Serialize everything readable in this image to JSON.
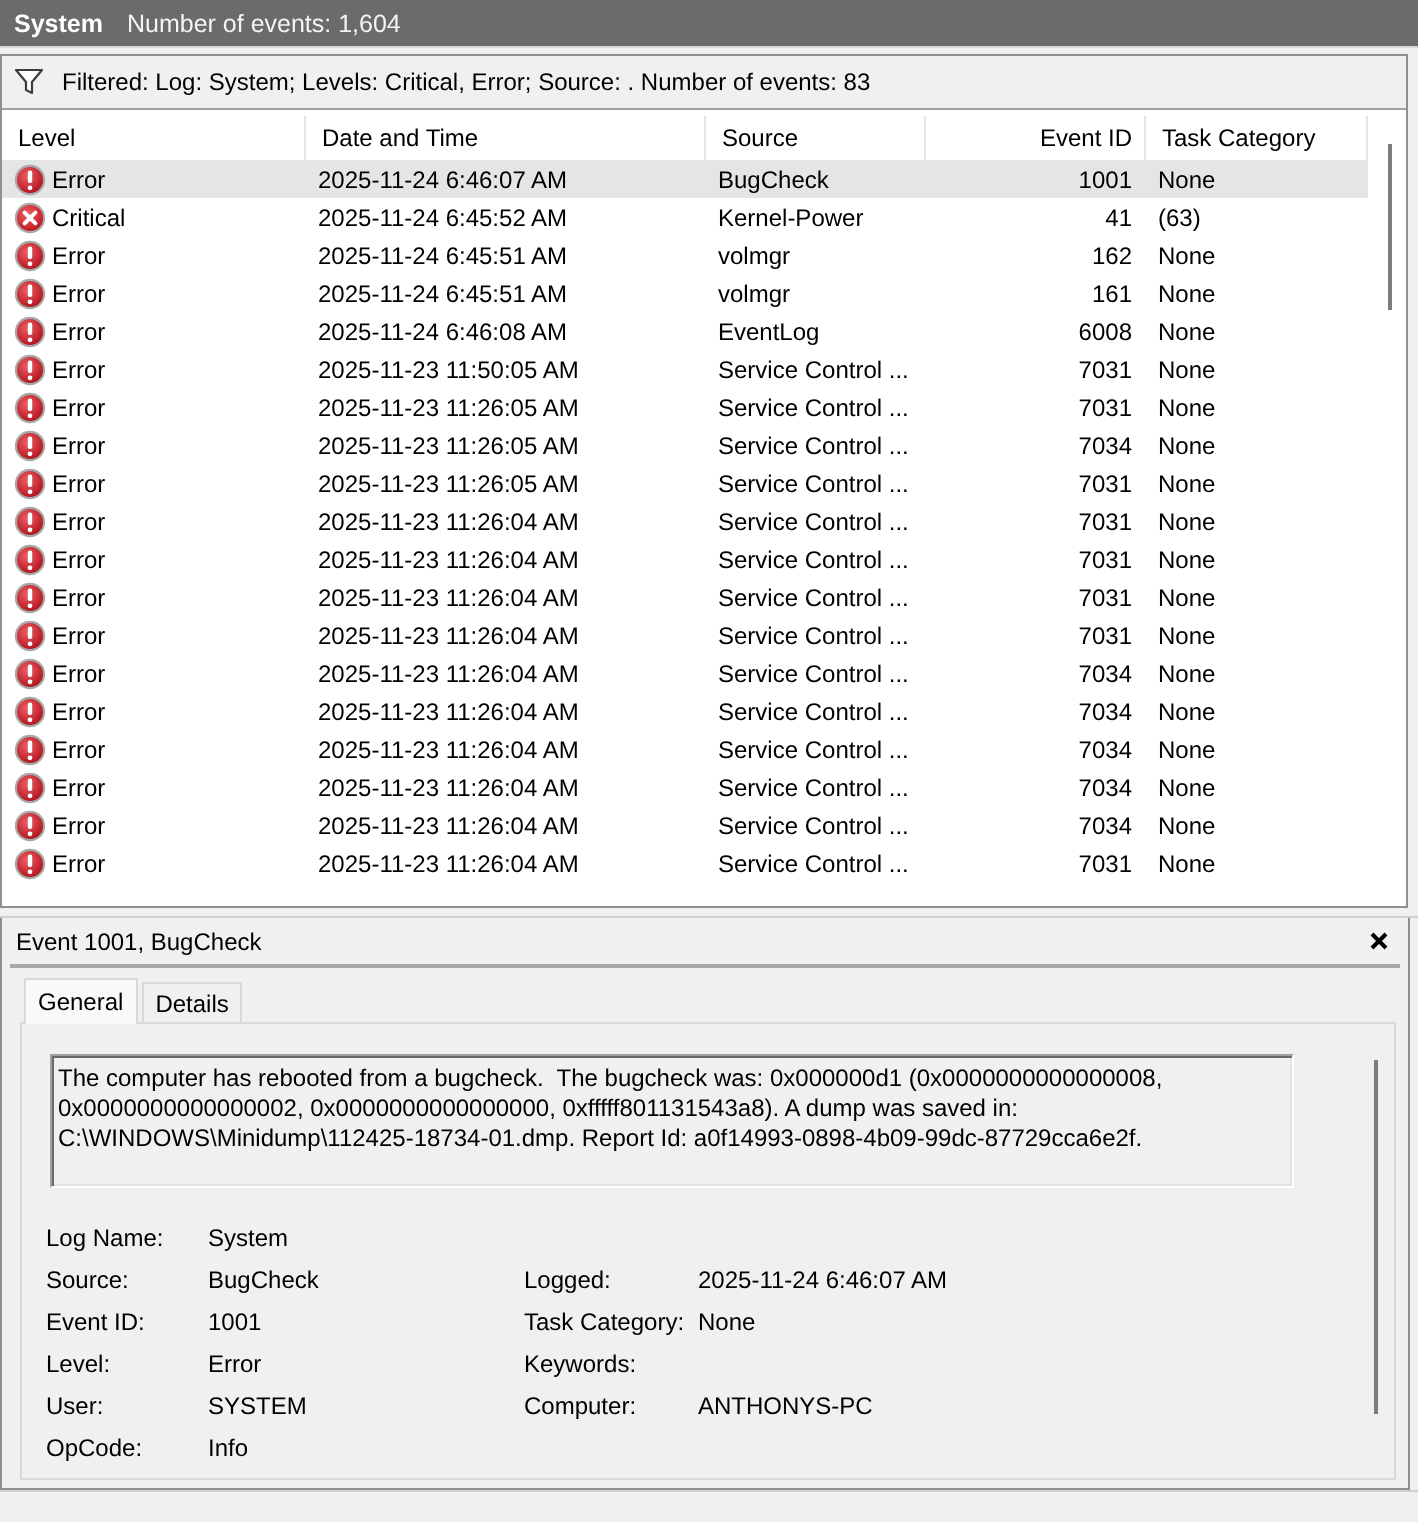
{
  "header": {
    "title": "System",
    "event_count": "Number of events: 1,604"
  },
  "filter_bar": {
    "text": "Filtered: Log: System; Levels: Critical, Error; Source: . Number of events: 83"
  },
  "table": {
    "columns": [
      "Level",
      "Date and Time",
      "Source",
      "Event ID",
      "Task Category"
    ],
    "rows": [
      {
        "kind": "error",
        "level": "Error",
        "date_time": "2025-11-24 6:46:07 AM",
        "source": "BugCheck",
        "event_id": "1001",
        "task_category": "None",
        "selected": true
      },
      {
        "kind": "critical",
        "level": "Critical",
        "date_time": "2025-11-24 6:45:52 AM",
        "source": "Kernel-Power",
        "event_id": "41",
        "task_category": "(63)",
        "selected": false
      },
      {
        "kind": "error",
        "level": "Error",
        "date_time": "2025-11-24 6:45:51 AM",
        "source": "volmgr",
        "event_id": "162",
        "task_category": "None",
        "selected": false
      },
      {
        "kind": "error",
        "level": "Error",
        "date_time": "2025-11-24 6:45:51 AM",
        "source": "volmgr",
        "event_id": "161",
        "task_category": "None",
        "selected": false
      },
      {
        "kind": "error",
        "level": "Error",
        "date_time": "2025-11-24 6:46:08 AM",
        "source": "EventLog",
        "event_id": "6008",
        "task_category": "None",
        "selected": false
      },
      {
        "kind": "error",
        "level": "Error",
        "date_time": "2025-11-23 11:50:05 AM",
        "source": "Service Control ...",
        "event_id": "7031",
        "task_category": "None",
        "selected": false
      },
      {
        "kind": "error",
        "level": "Error",
        "date_time": "2025-11-23 11:26:05 AM",
        "source": "Service Control ...",
        "event_id": "7031",
        "task_category": "None",
        "selected": false
      },
      {
        "kind": "error",
        "level": "Error",
        "date_time": "2025-11-23 11:26:05 AM",
        "source": "Service Control ...",
        "event_id": "7034",
        "task_category": "None",
        "selected": false
      },
      {
        "kind": "error",
        "level": "Error",
        "date_time": "2025-11-23 11:26:05 AM",
        "source": "Service Control ...",
        "event_id": "7031",
        "task_category": "None",
        "selected": false
      },
      {
        "kind": "error",
        "level": "Error",
        "date_time": "2025-11-23 11:26:04 AM",
        "source": "Service Control ...",
        "event_id": "7031",
        "task_category": "None",
        "selected": false
      },
      {
        "kind": "error",
        "level": "Error",
        "date_time": "2025-11-23 11:26:04 AM",
        "source": "Service Control ...",
        "event_id": "7031",
        "task_category": "None",
        "selected": false
      },
      {
        "kind": "error",
        "level": "Error",
        "date_time": "2025-11-23 11:26:04 AM",
        "source": "Service Control ...",
        "event_id": "7031",
        "task_category": "None",
        "selected": false
      },
      {
        "kind": "error",
        "level": "Error",
        "date_time": "2025-11-23 11:26:04 AM",
        "source": "Service Control ...",
        "event_id": "7031",
        "task_category": "None",
        "selected": false
      },
      {
        "kind": "error",
        "level": "Error",
        "date_time": "2025-11-23 11:26:04 AM",
        "source": "Service Control ...",
        "event_id": "7034",
        "task_category": "None",
        "selected": false
      },
      {
        "kind": "error",
        "level": "Error",
        "date_time": "2025-11-23 11:26:04 AM",
        "source": "Service Control ...",
        "event_id": "7034",
        "task_category": "None",
        "selected": false
      },
      {
        "kind": "error",
        "level": "Error",
        "date_time": "2025-11-23 11:26:04 AM",
        "source": "Service Control ...",
        "event_id": "7034",
        "task_category": "None",
        "selected": false
      },
      {
        "kind": "error",
        "level": "Error",
        "date_time": "2025-11-23 11:26:04 AM",
        "source": "Service Control ...",
        "event_id": "7034",
        "task_category": "None",
        "selected": false
      },
      {
        "kind": "error",
        "level": "Error",
        "date_time": "2025-11-23 11:26:04 AM",
        "source": "Service Control ...",
        "event_id": "7034",
        "task_category": "None",
        "selected": false
      },
      {
        "kind": "error",
        "level": "Error",
        "date_time": "2025-11-23 11:26:04 AM",
        "source": "Service Control ...",
        "event_id": "7031",
        "task_category": "None",
        "selected": false
      }
    ]
  },
  "details": {
    "title": "Event 1001, BugCheck",
    "tabs": [
      {
        "label": "General",
        "selected": true
      },
      {
        "label": "Details",
        "selected": false
      }
    ],
    "description": "The computer has rebooted from a bugcheck.  The bugcheck was: 0x000000d1 (0x0000000000000008, 0x0000000000000002, 0x0000000000000000, 0xfffff801131543a8). A dump was saved in: C:\\WINDOWS\\Minidump\\112425-18734-01.dmp. Report Id: a0f14993-0898-4b09-99dc-87729cca6e2f.",
    "field_rows": [
      {
        "fields": [
          {
            "label": "Log Name:",
            "value": "System"
          }
        ]
      },
      {
        "fields": [
          {
            "label": "Source:",
            "value": "BugCheck"
          },
          {
            "label": "Logged:",
            "value": "2025-11-24 6:46:07 AM"
          }
        ]
      },
      {
        "fields": [
          {
            "label": "Event ID:",
            "value": "1001"
          },
          {
            "label": "Task Category:",
            "value": "None"
          }
        ]
      },
      {
        "fields": [
          {
            "label": "Level:",
            "value": "Error"
          },
          {
            "label": "Keywords:"
          }
        ]
      },
      {
        "fields": [
          {
            "label": "User:",
            "value": "SYSTEM"
          },
          {
            "label": "Computer:",
            "value": "ANTHONYS-PC"
          }
        ]
      },
      {
        "fields": [
          {
            "label": "OpCode:",
            "value": "Info"
          }
        ]
      }
    ]
  }
}
